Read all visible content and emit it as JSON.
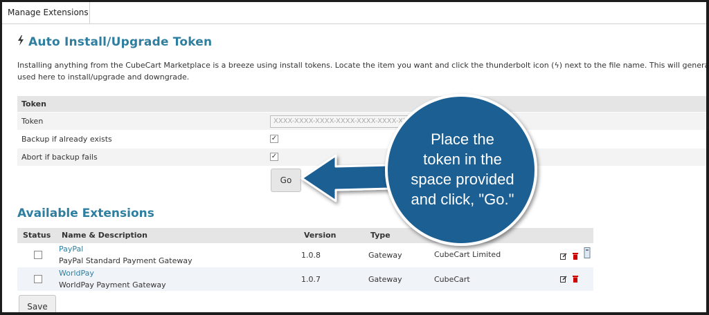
{
  "tab": {
    "label": "Manage Extensions"
  },
  "install": {
    "title": "Auto Install/Upgrade Token",
    "intro_line1": "Installing anything from the CubeCart Marketplace is a breeze using install tokens. Locate the item you want and click the thunderbolt icon (ϟ) next to the file name. This will generat",
    "intro_line2": "used here to install/upgrade and downgrade.",
    "table_header": "Token",
    "token_label": "Token",
    "token_value": "XXXX-XXXX-XXXX-XXXX-XXXX-XXXX-XX",
    "backup_label": "Backup if already exists",
    "abort_label": "Abort if backup fails",
    "go_label": "Go"
  },
  "extensions": {
    "title": "Available Extensions",
    "columns": [
      "Status",
      "Name & Description",
      "Version",
      "Type"
    ],
    "rows": [
      {
        "name": "PayPal",
        "description": "PayPal Standard Payment Gateway",
        "version": "1.0.8",
        "type": "Gateway",
        "developer": "CubeCart Limited"
      },
      {
        "name": "WorldPay",
        "description": "WorldPay Payment Gateway",
        "version": "1.0.7",
        "type": "Gateway",
        "developer": "CubeCart"
      }
    ],
    "save_label": "Save"
  },
  "callout": {
    "line1": "Place the",
    "line2": "token in the",
    "line3": "space provided",
    "line4": "and click, \"Go.\""
  },
  "colors": {
    "accent": "#2e7ea0",
    "callout": "#1d5f93",
    "delete": "#cc0000"
  }
}
